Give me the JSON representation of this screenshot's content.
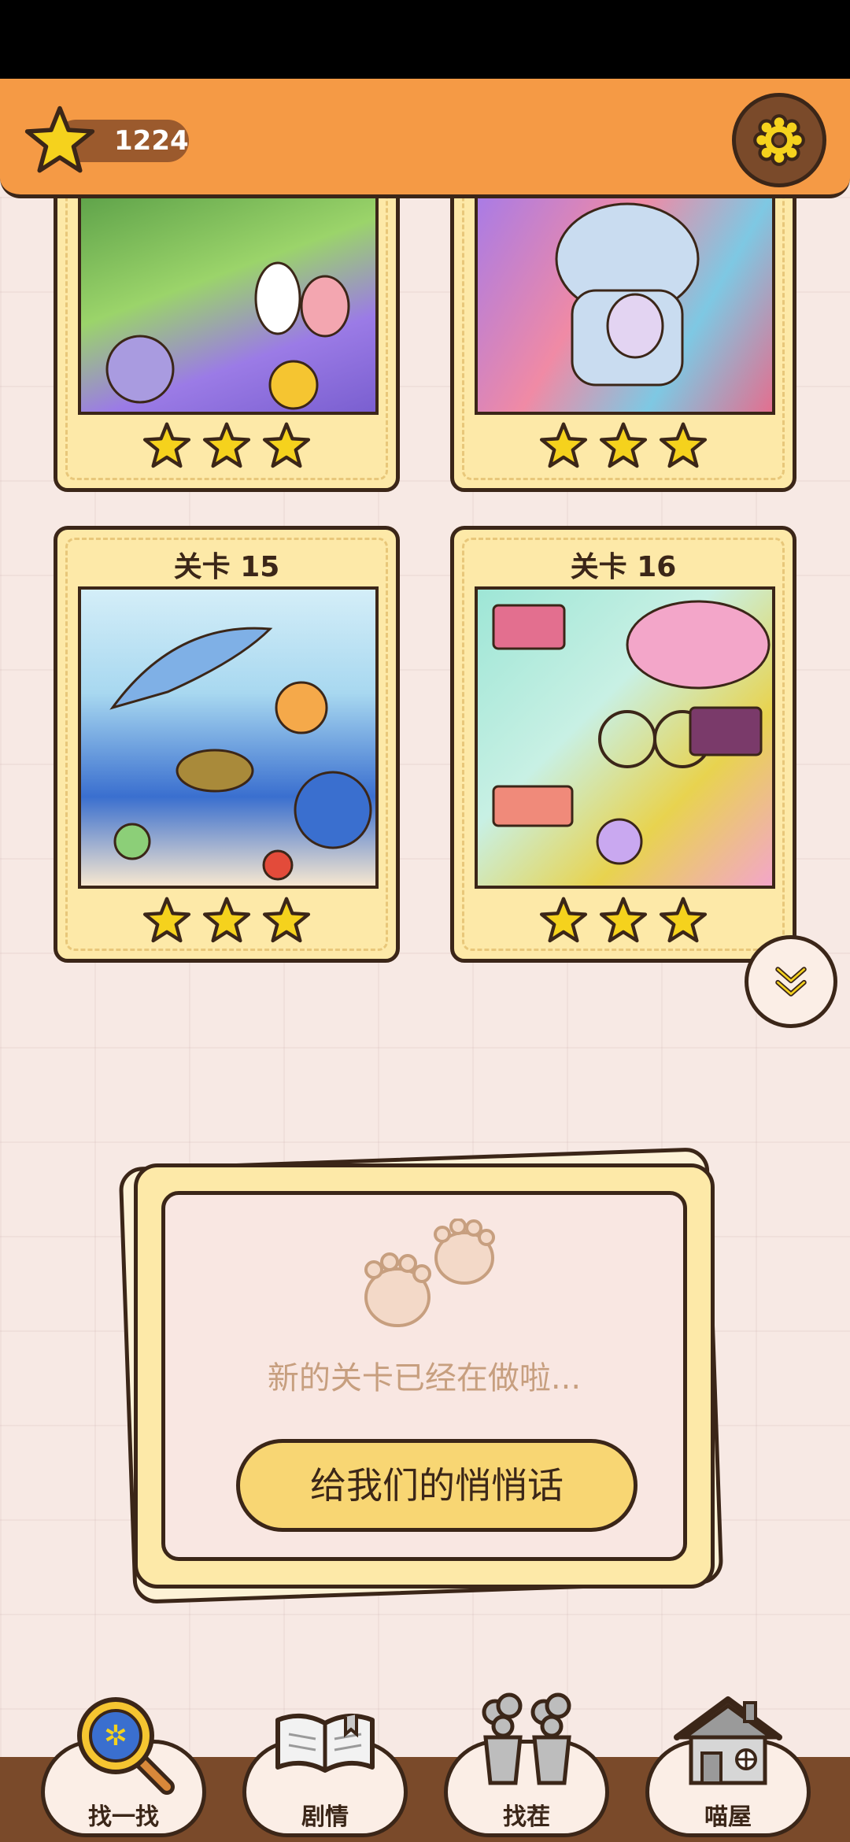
{
  "status_bar": {},
  "header": {
    "star_count": "1224"
  },
  "levels": [
    {
      "title": "",
      "stars": 3,
      "art_palette": [
        "#9b7be6",
        "#5fa34a",
        "#f3c6c9"
      ]
    },
    {
      "title": "",
      "stars": 3,
      "art_palette": [
        "#a97be6",
        "#f08aa5",
        "#7ec8e3"
      ]
    },
    {
      "title": "关卡 15",
      "stars": 3,
      "art_palette": [
        "#a8d8f0",
        "#3a6fcf",
        "#f08a5a"
      ]
    },
    {
      "title": "关卡 16",
      "stars": 3,
      "art_palette": [
        "#9ee6d6",
        "#f3a6c9",
        "#e8d34f"
      ]
    }
  ],
  "panel": {
    "message": "新的关卡已经在做啦...",
    "button_label": "给我们的悄悄话"
  },
  "nav": [
    {
      "label": "找一找",
      "icon": "magnifier-icon"
    },
    {
      "label": "剧情",
      "icon": "book-icon"
    },
    {
      "label": "找茬",
      "icon": "plant-pots-icon"
    },
    {
      "label": "喵屋",
      "icon": "house-icon"
    }
  ],
  "colors": {
    "accent": "#f59a45",
    "card": "#fde9a8",
    "outline": "#3b2618",
    "star": "#f5d21d"
  }
}
